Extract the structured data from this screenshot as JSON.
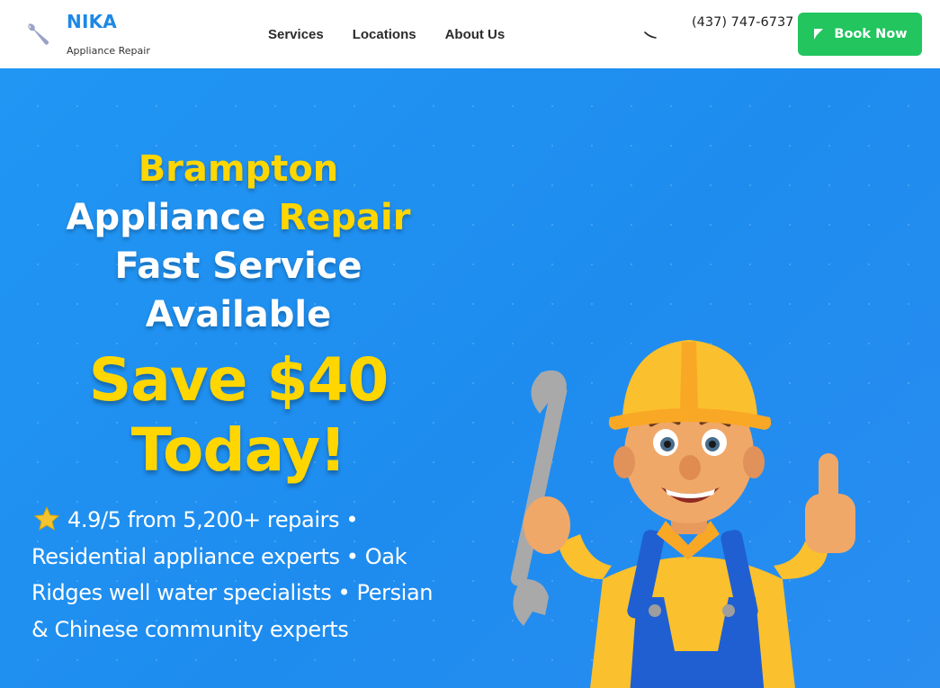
{
  "brand": {
    "name": "NIKA",
    "tagline": "Appliance Repair"
  },
  "nav": {
    "items": [
      {
        "label": "Services"
      },
      {
        "label": "Locations"
      },
      {
        "label": "About Us"
      }
    ]
  },
  "contact": {
    "phone": "(437) 747-6737",
    "book_label": "Book Now"
  },
  "hero": {
    "headline": {
      "city": "Brampton",
      "word_appliance": "Appliance",
      "word_repair": "Repair",
      "line_fast": "Fast Service",
      "line_available": "Available"
    },
    "promo_line1": "Save $40",
    "promo_line2": "Today!",
    "rating_text": "4.9/5 from 5,200+ repairs • Residential appliance experts • Oak Ridges well water specialists • Persian & Chinese community experts"
  },
  "colors": {
    "brand_blue": "#1e88e5",
    "hero_blue": "#2196f3",
    "accent_yellow": "#ffd600",
    "cta_green": "#22c55e"
  },
  "icons": {
    "logo": "wrench-icon",
    "phone": "phone-icon",
    "book": "pencil-icon",
    "rating": "star-icon",
    "mascot": "repairman-illustration"
  }
}
